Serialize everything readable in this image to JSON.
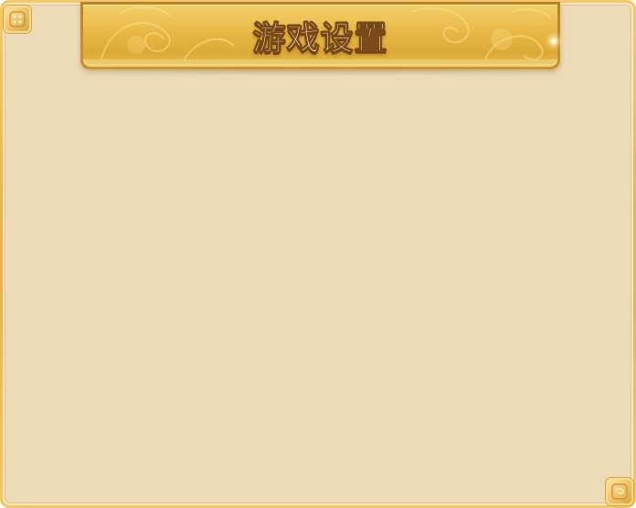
{
  "dialog": {
    "title": "游戏设置"
  },
  "theme": {
    "frame_gold": "#e8b24c",
    "panel_fill": "#eddbb8",
    "banner_gold": "#e8b845",
    "title_outline": "#7a4a16"
  },
  "icons": {
    "corner_top_left": "corner-ornament-icon",
    "corner_bottom_right": "corner-ornament-icon"
  }
}
